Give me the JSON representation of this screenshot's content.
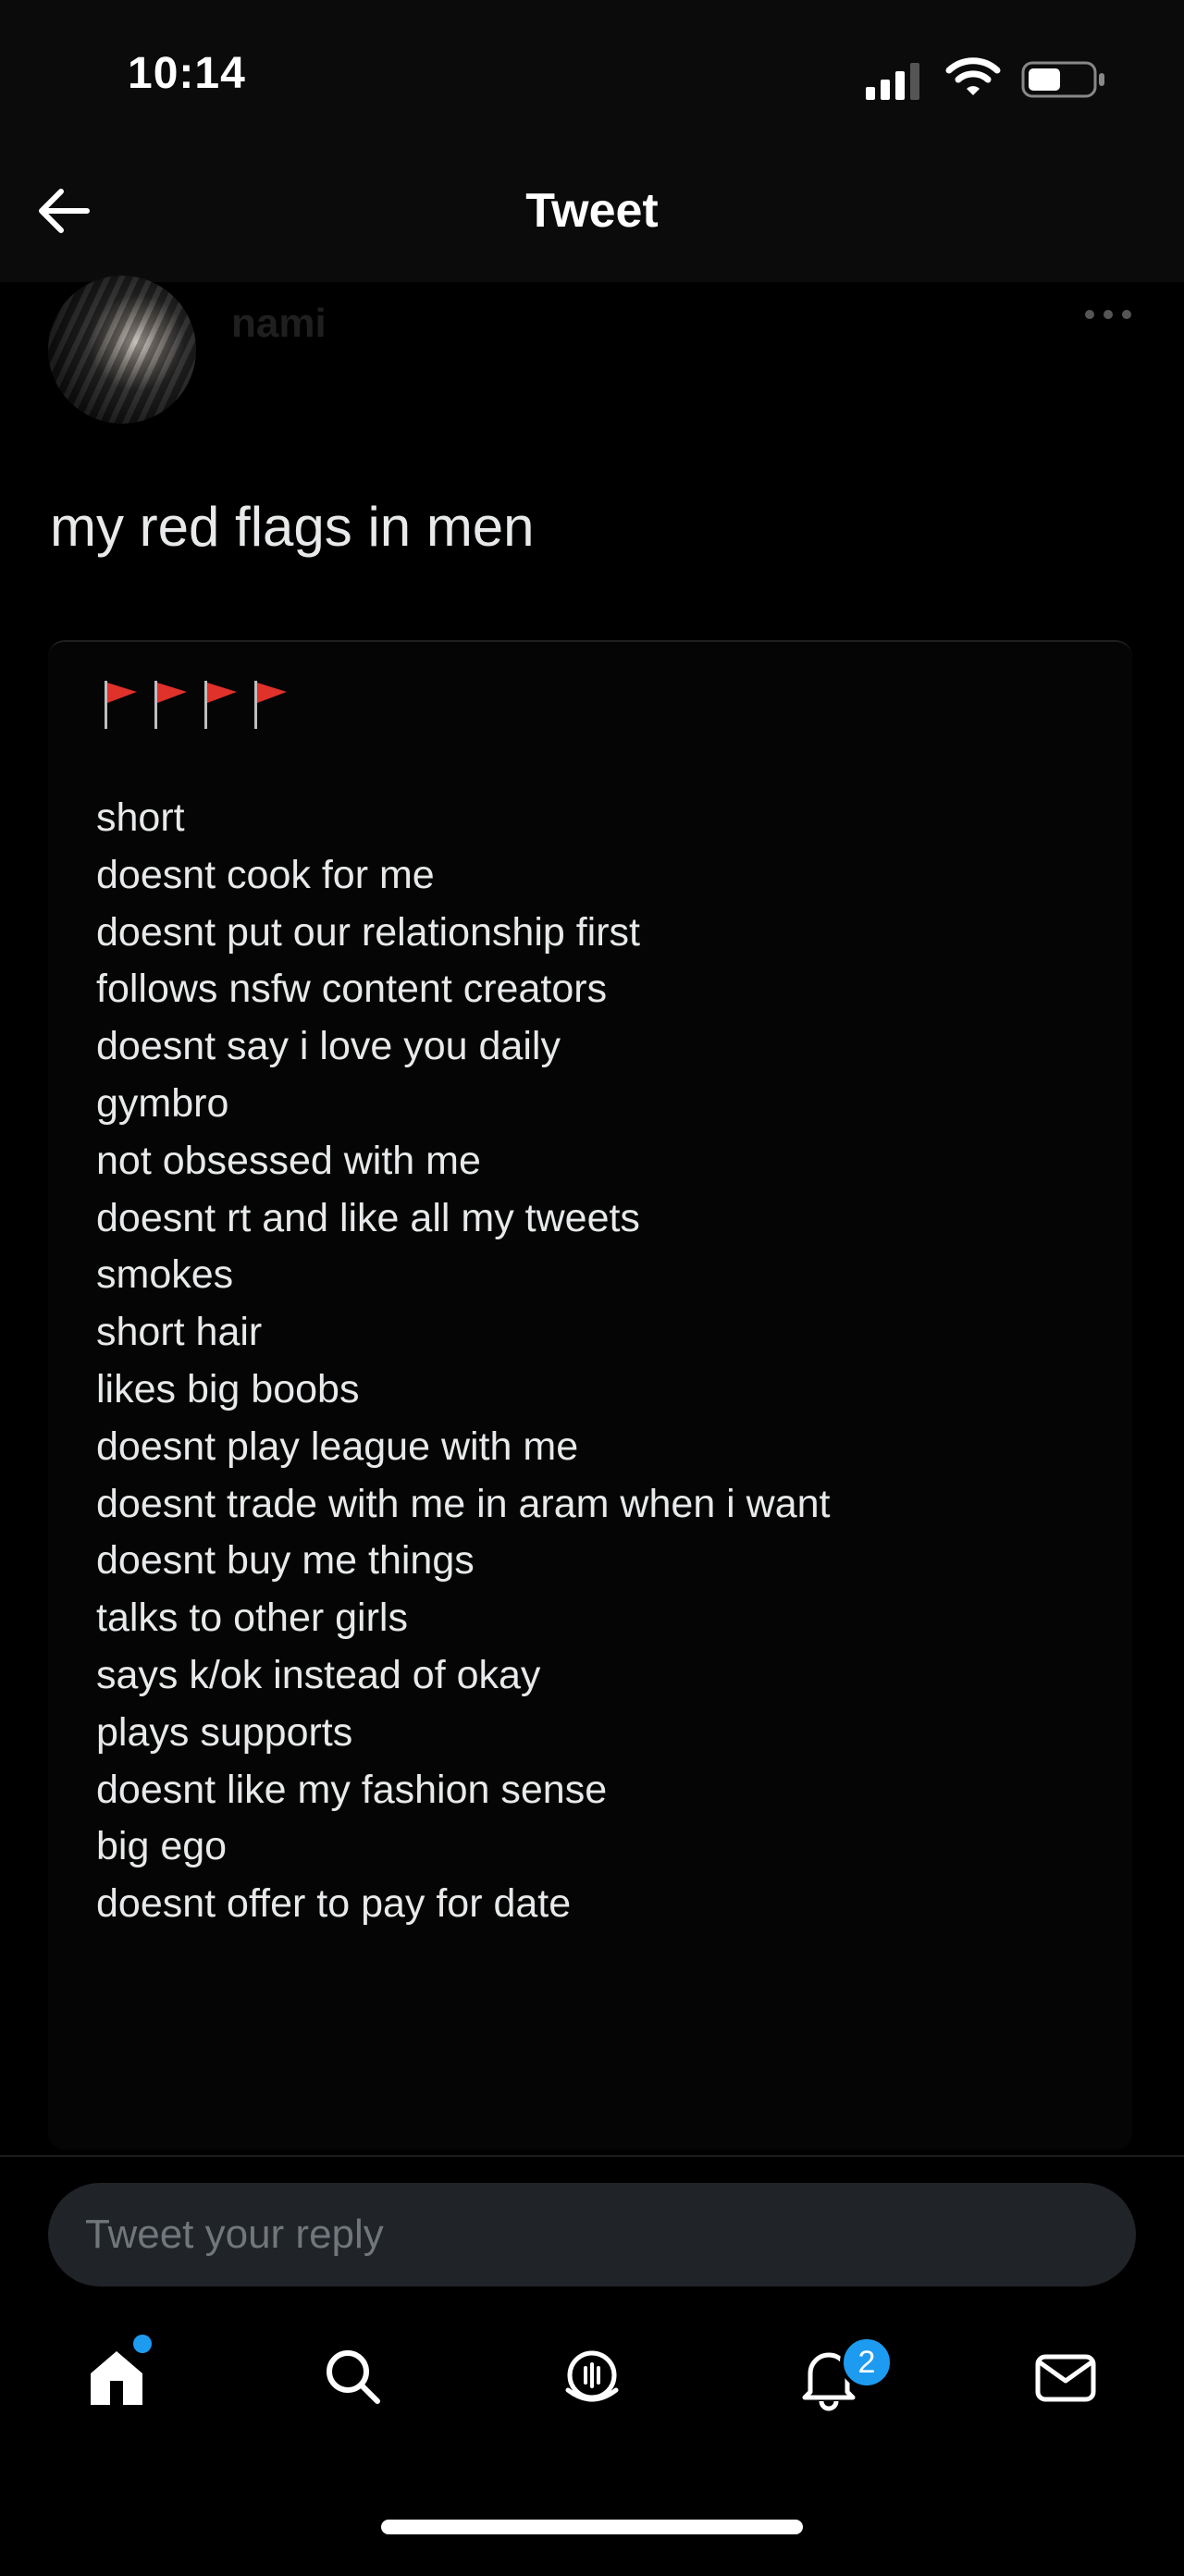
{
  "status_bar": {
    "time": "10:14"
  },
  "header": {
    "title": "Tweet"
  },
  "tweet": {
    "author_name": "nami",
    "author_handle": "",
    "text": "my red flags in men",
    "flag_emojis": [
      "red-flag",
      "red-flag",
      "red-flag",
      "red-flag"
    ],
    "list": [
      "short",
      "doesnt cook for me",
      "doesnt put our relationship first",
      "follows nsfw content creators",
      "doesnt say i love you daily",
      "gymbro",
      "not obsessed with me",
      "doesnt rt and like all my tweets",
      "smokes",
      "short hair",
      "likes big boobs",
      "doesnt play league with me",
      "doesnt trade with me in aram when i want",
      "doesnt buy me things",
      "talks to other girls",
      "says k/ok instead of okay",
      "plays supports",
      "doesnt like my fashion sense",
      "big ego",
      "doesnt offer to pay for date"
    ]
  },
  "reply": {
    "placeholder": "Tweet your reply"
  },
  "nav": {
    "items": [
      "home-icon",
      "search-icon",
      "spaces-icon",
      "notifications-icon",
      "messages-icon"
    ],
    "notifications_count": "2"
  },
  "colors": {
    "background": "#000000",
    "accent": "#1d9bf0",
    "flag": "#e0312b",
    "text": "#e7e9ea",
    "placeholder": "#71767b"
  }
}
